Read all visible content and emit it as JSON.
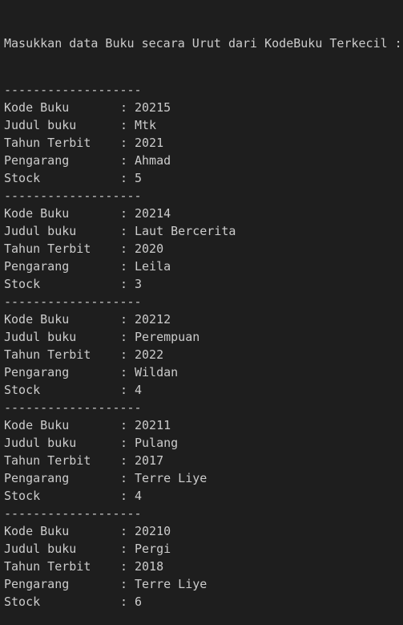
{
  "terminal": {
    "header": "Masukkan data Buku secara Urut dari KodeBuku Terkecil :",
    "separator": "-------------------",
    "colon": ":",
    "labels": {
      "kode": "Kode Buku",
      "judul": "Judul buku",
      "tahun": "Tahun Terbit",
      "pengarang": "Pengarang",
      "stock": "Stock"
    },
    "books": [
      {
        "kode": "20215",
        "judul": "Mtk",
        "tahun": "2021",
        "pengarang": "Ahmad",
        "stock": "5"
      },
      {
        "kode": "20214",
        "judul": "Laut Bercerita",
        "tahun": "2020",
        "pengarang": "Leila",
        "stock": "3"
      },
      {
        "kode": "20212",
        "judul": "Perempuan",
        "tahun": "2022",
        "pengarang": "Wildan",
        "stock": "4"
      },
      {
        "kode": "20211",
        "judul": "Pulang",
        "tahun": "2017",
        "pengarang": "Terre Liye",
        "stock": "4"
      },
      {
        "kode": "20210",
        "judul": "Pergi",
        "tahun": "2018",
        "pengarang": "Terre Liye",
        "stock": "6"
      }
    ]
  }
}
